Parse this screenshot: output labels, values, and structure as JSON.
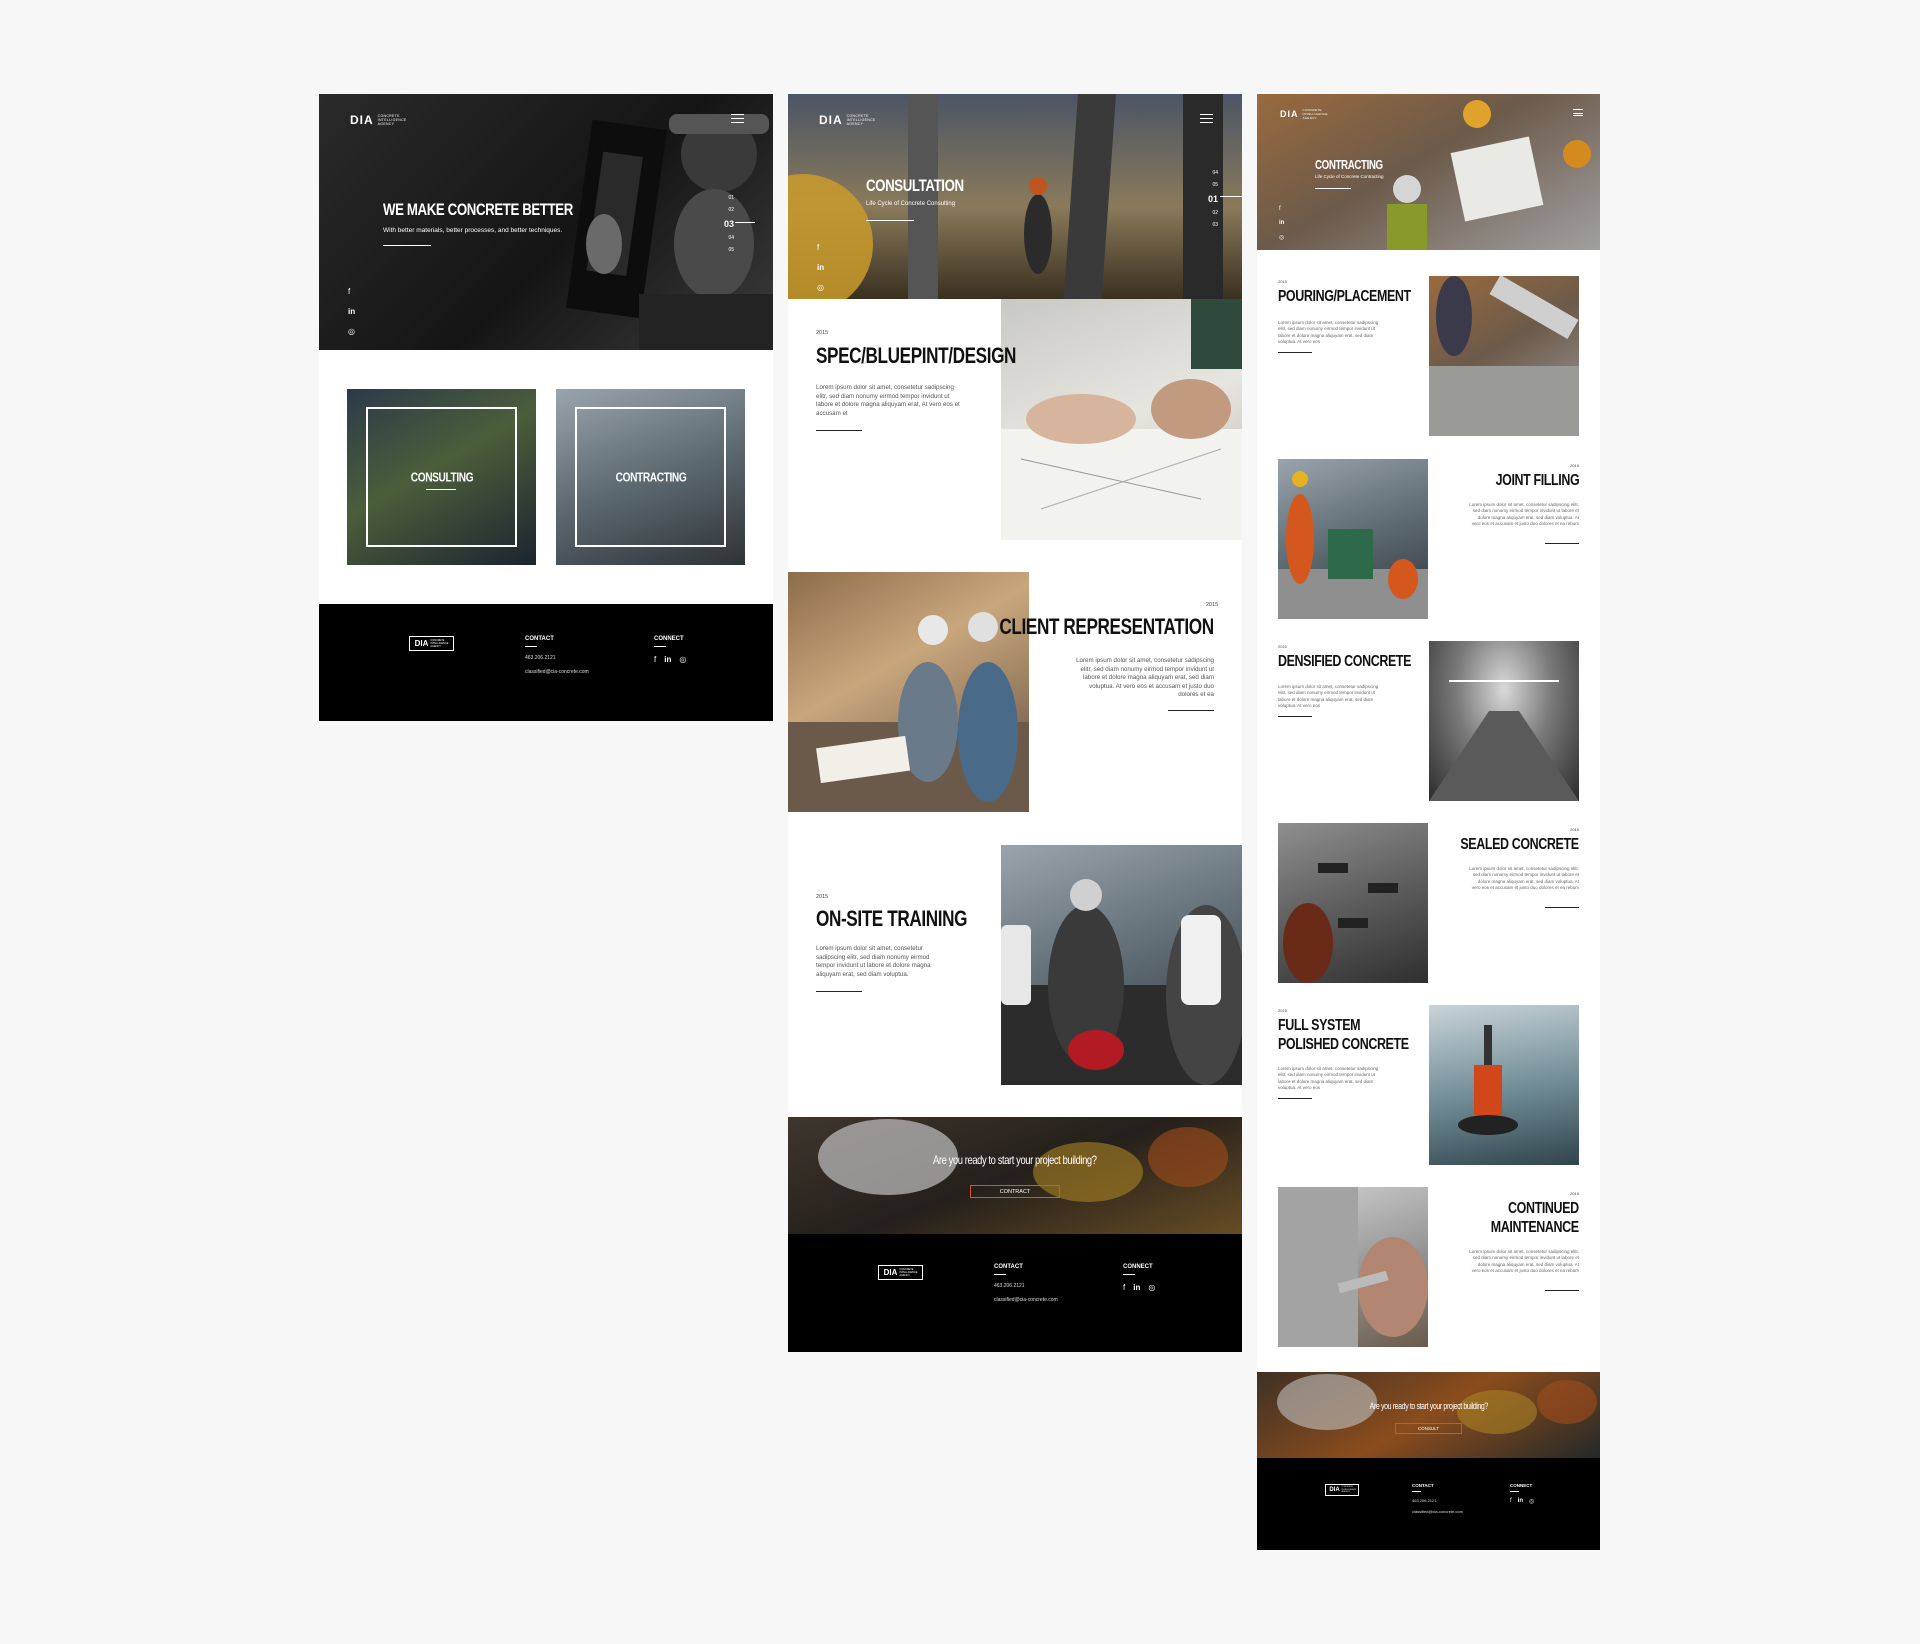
{
  "brand": {
    "mark": "DIA",
    "tagline": "Concrete Intelligence Agency"
  },
  "home": {
    "hero_title": "WE MAKE CONCRETE BETTER",
    "hero_subtitle": "With better materials, better processes, and better techniques.",
    "pager": [
      "01",
      "02",
      "03",
      "04",
      "05"
    ],
    "pager_active_index": 2,
    "cards": [
      {
        "label": "CONSULTING"
      },
      {
        "label": "CONTRACTING"
      }
    ]
  },
  "social": {
    "icons": [
      "facebook-icon",
      "linkedin-icon",
      "instagram-icon"
    ],
    "glyphs": [
      "f",
      "in",
      "◎"
    ]
  },
  "footer": {
    "contact_heading": "CONTACT",
    "phone": "463.206.2121",
    "email": "classified@cia-concrete.com",
    "connect_heading": "CONNECT"
  },
  "consultation": {
    "hero_title": "CONSULTATION",
    "hero_subtitle": "Life Cycle of Concrete Consulting",
    "pager": [
      "04",
      "05",
      "01",
      "02",
      "03"
    ],
    "pager_active_index": 2,
    "sections": [
      {
        "year": "2015",
        "title": "SPEC/BLUEPINT/DESIGN",
        "body": "Lorem ipsum dolor sit amet, consetetur sadipscing elitr, sed diam nonumy eirmod tempor invidunt ut labore et dolore magna aliquyam erat, At vero eos et accusam et"
      },
      {
        "year": "2015",
        "title": "CLIENT REPRESENTATION",
        "body": "Lorem ipsum dolor sit amet, consetetur sadipscing elitr, sed diam nonumy eirmod tempor invidunt ut labore et dolore magna aliquyam erat, sed diam voluptua. At vero eos et accusam et justo duo dolores et ea"
      },
      {
        "year": "2015",
        "title": "ON-SITE TRAINING",
        "body": "Lorem ipsum dolor sit amet, consetetur sadipscing elitr, sed diam nonumy eirmod tempor invidunt ut labore et dolore magna aliquyam erat, sed diam voluptua."
      }
    ],
    "cta_text": "Are you ready to start your project building?",
    "cta_button": "CONTRACT"
  },
  "contracting": {
    "hero_title": "CONTRACTING",
    "hero_subtitle": "Life Cycle of Concrete Contracting",
    "sections": [
      {
        "year": "2015",
        "title_lines": [
          "POURING/PLACEMENT"
        ],
        "body": "Lorem ipsum dolor sit amet, consetetur sadipscing elitr, sed diam nonumy eirmod tempor invidunt ut labore et dolore magna aliquyam erat, sed diam voluptua. At vero eos"
      },
      {
        "year": "2015",
        "title_lines": [
          "JOINT FILLING"
        ],
        "body": "Lorem ipsum dolor sit amet, consetetur sadipscing elitr, sed diam nonumy eirmod tempor invidunt ut labore et dolore magna aliquyam erat, sed diam voluptua. At vero eos et accusam et justo duo dolores et ea rebum"
      },
      {
        "year": "2015",
        "title_lines": [
          "DENSIFIED CONCRETE"
        ],
        "body": "Lorem ipsum dolor sit amet, consetetur sadipscing elitr, sed diam nonumy eirmod tempor invidunt ut labore et dolore magna aliquyam erat, sed diam voluptua. At vero eos"
      },
      {
        "year": "2015",
        "title_lines": [
          "SEALED CONCRETE"
        ],
        "body": "Lorem ipsum dolor sit amet, consetetur sadipscing elitr, sed diam nonumy eirmod tempor invidunt ut labore et dolore magna aliquyam erat, sed diam voluptua. At vero eos et accusam et justo duo dolores et ea rebum"
      },
      {
        "year": "2015",
        "title_lines": [
          "FULL SYSTEM",
          "POLISHED CONCRETE"
        ],
        "body": "Lorem ipsum dolor sit amet, consetetur sadipscing elitr, sed diam nonumy eirmod tempor invidunt ut labore et dolore magna aliquyam erat, sed diam voluptua. At vero eos"
      },
      {
        "year": "2015",
        "title_lines": [
          "CONTINUED",
          "MAINTENANCE"
        ],
        "body": "Lorem ipsum dolor sit amet, consetetur sadipscing elitr, sed diam nonumy eirmod tempor invidunt ut labore et dolore magna aliquyam erat, sed diam voluptua. At vero eos et accusam et justo duo dolores et ea rebum"
      }
    ],
    "cta_text": "Are you ready to start your project building?",
    "cta_button": "CONSULT"
  },
  "colors": {
    "background": "#f7f7f7",
    "footer": "#000000",
    "text": "#111111",
    "accent": "#d9532b"
  }
}
